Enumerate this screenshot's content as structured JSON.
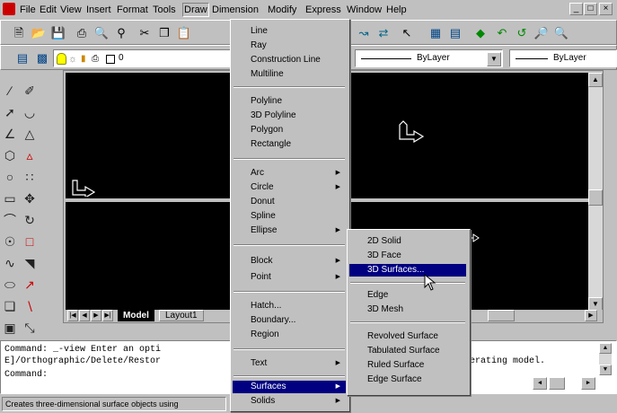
{
  "menubar": {
    "items": [
      "File",
      "Edit",
      "View",
      "Insert",
      "Format",
      "Tools",
      "Draw",
      "Dimension",
      "Modify",
      "Express",
      "Window",
      "Help"
    ],
    "window_buttons": [
      "_",
      "□",
      "×"
    ]
  },
  "layer_toolbar": {
    "layer_name": "0",
    "linetype": "ByLayer",
    "lineweight": "ByLayer"
  },
  "draw_menu": {
    "items": [
      "Line",
      "Ray",
      "Construction Line",
      "Multiline",
      "Polyline",
      "3D Polyline",
      "Polygon",
      "Rectangle",
      "Arc",
      "Circle",
      "Donut",
      "Spline",
      "Ellipse",
      "Block",
      "Point",
      "Hatch...",
      "Boundary...",
      "Region",
      "Text",
      "Surfaces",
      "Solids"
    ]
  },
  "surfaces_menu": {
    "items": [
      "2D Solid",
      "3D Face",
      "3D Surfaces...",
      "Edge",
      "3D Mesh",
      "Revolved Surface",
      "Tabulated Surface",
      "Ruled Surface",
      "Edge Surface"
    ]
  },
  "layout_tabs": [
    "Model",
    "Layout1"
  ],
  "command_line": {
    "line1": "Command: _-view Enter an opti",
    "line2": "E]/Orthographic/Delete/Restor",
    "line3": "Command:",
    "right_text": "erating model."
  },
  "status_bar": {
    "text": "Creates three-dimensional surface objects using"
  },
  "colors": {
    "menu_highlight": "#000080",
    "viewport_bg": "#000000",
    "chrome": "#c0c0c0"
  }
}
